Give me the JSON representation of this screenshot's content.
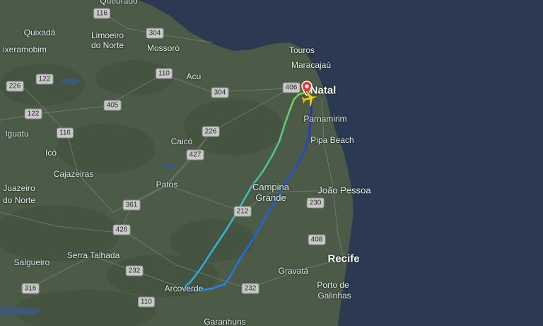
{
  "map": {
    "colors": {
      "ocean": "#2b3a52",
      "land": "#4b5b47",
      "land_dark": "#3f4f3c",
      "route_start": "#1e2fd0",
      "route_mid": "#20a8ff",
      "route_end": "#7fe03a",
      "pin": "#e23b3b",
      "plane": "#f0d020"
    },
    "places": [
      {
        "name": "Natal",
        "size": "big"
      },
      {
        "name": "Recife",
        "size": "big"
      },
      {
        "name": "João Pessoa",
        "size": "med"
      },
      {
        "name": "Campina Grande",
        "size": "med"
      },
      {
        "name": "Parnamirim",
        "size": "norm"
      },
      {
        "name": "Pipa Beach",
        "size": "norm"
      },
      {
        "name": "Touros",
        "size": "norm"
      },
      {
        "name": "Maracajaú",
        "size": "norm"
      },
      {
        "name": "Mossoró",
        "size": "norm"
      },
      {
        "name": "Limoeiro",
        "size": "norm"
      },
      {
        "name": "do Norte",
        "size": "norm"
      },
      {
        "name": "Quixadá",
        "size": "norm"
      },
      {
        "name": "ixeramobim",
        "size": "norm"
      },
      {
        "name": "Acu",
        "size": "norm"
      },
      {
        "name": "Caicó",
        "size": "norm"
      },
      {
        "name": "Iguatu",
        "size": "norm"
      },
      {
        "name": "Icó",
        "size": "norm"
      },
      {
        "name": "Cajazeiras",
        "size": "norm"
      },
      {
        "name": "Juazeiro",
        "size": "norm"
      },
      {
        "name": "do Norte",
        "size": "norm"
      },
      {
        "name": "Patos",
        "size": "norm"
      },
      {
        "name": "Serra Talhada",
        "size": "norm"
      },
      {
        "name": "Salgueiro",
        "size": "norm"
      },
      {
        "name": "Arcoverde",
        "size": "norm"
      },
      {
        "name": "Gravatá",
        "size": "norm"
      },
      {
        "name": "Porto de",
        "size": "norm"
      },
      {
        "name": "Galinhas",
        "size": "norm"
      },
      {
        "name": "Garanhuns",
        "size": "norm"
      },
      {
        "name": "Quebrado",
        "size": "norm"
      }
    ],
    "shields": [
      "116",
      "304",
      "110",
      "304",
      "226",
      "122",
      "405",
      "122",
      "116",
      "406",
      "226",
      "427",
      "230",
      "361",
      "212",
      "426",
      "408",
      "232",
      "316",
      "232",
      "110"
    ],
    "markers": [
      {
        "type": "origin-pin",
        "icon": "map-pin-icon"
      },
      {
        "type": "aircraft",
        "icon": "airplane-icon"
      }
    ]
  }
}
